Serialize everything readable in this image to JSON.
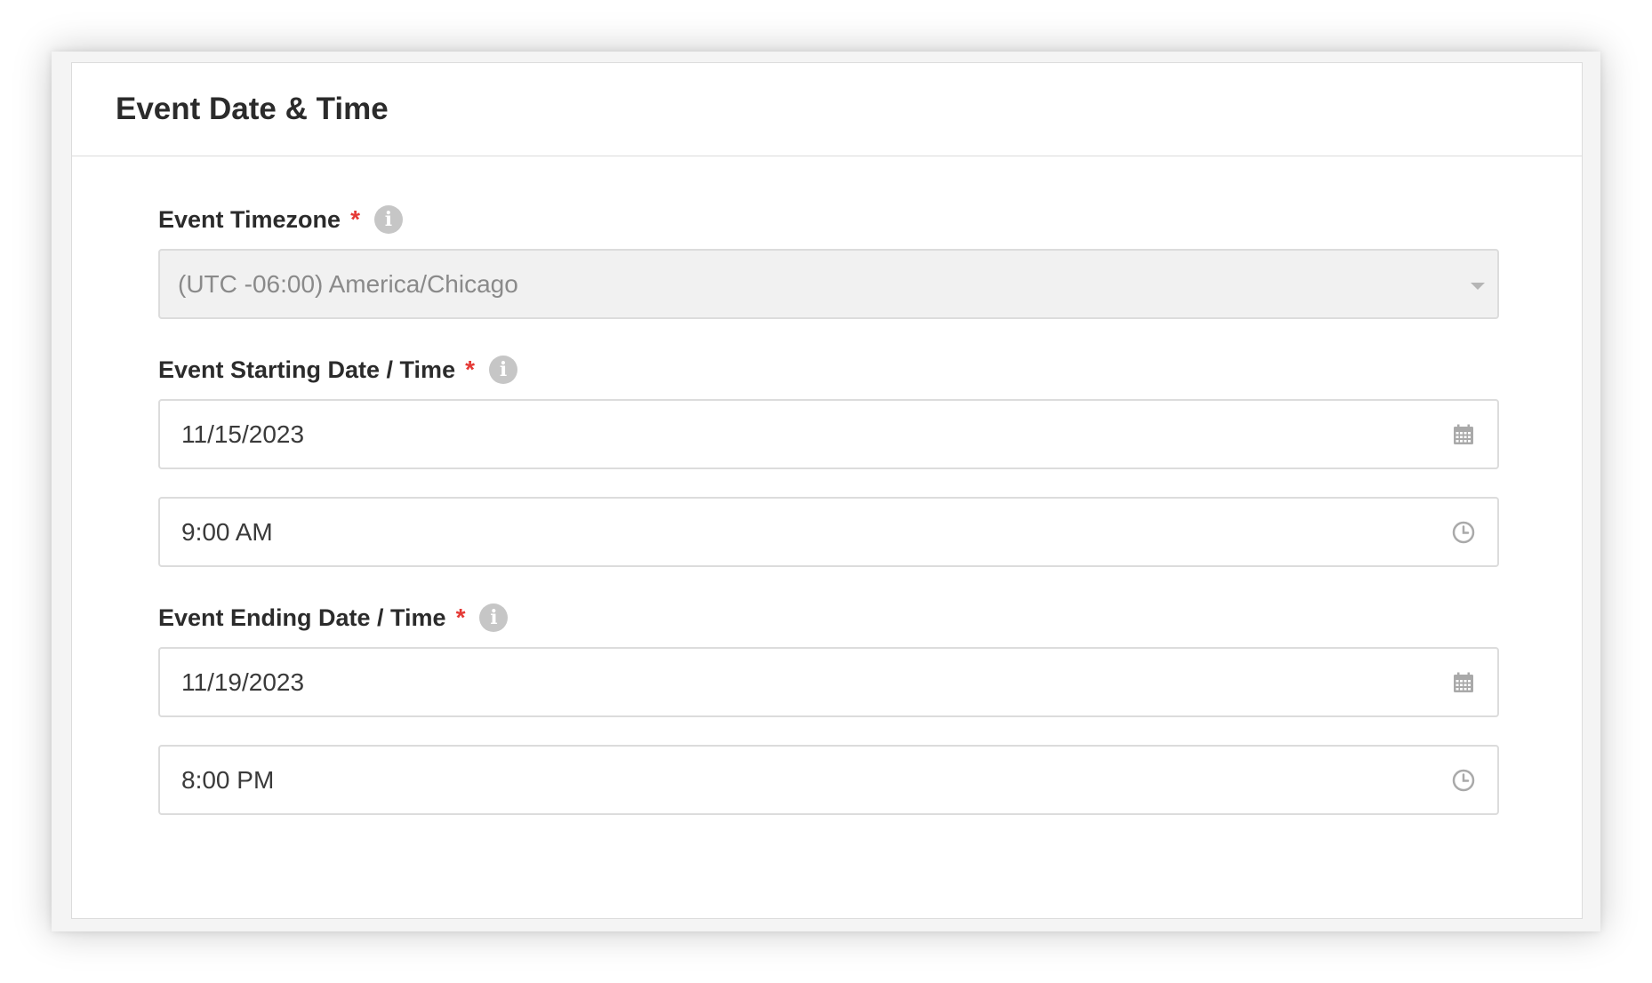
{
  "card": {
    "title": "Event Date & Time"
  },
  "fields": {
    "timezone": {
      "label": "Event Timezone",
      "required_mark": "*",
      "info_icon_glyph": "i",
      "value": "(UTC -06:00) America/Chicago",
      "icon": "chevron-down-icon"
    },
    "start": {
      "label": "Event Starting Date / Time",
      "required_mark": "*",
      "info_icon_glyph": "i",
      "date_value": "11/15/2023",
      "date_icon": "calendar-icon",
      "time_value": "9:00 AM",
      "time_icon": "clock-icon"
    },
    "end": {
      "label": "Event Ending Date / Time",
      "required_mark": "*",
      "info_icon_glyph": "i",
      "date_value": "11/19/2023",
      "date_icon": "calendar-icon",
      "time_value": "8:00 PM",
      "time_icon": "clock-icon"
    }
  },
  "colors": {
    "required": "#e53935",
    "info_icon_bg": "#c6c6c6",
    "disabled_bg": "#f1f1f1",
    "border": "#dcdcdc"
  }
}
